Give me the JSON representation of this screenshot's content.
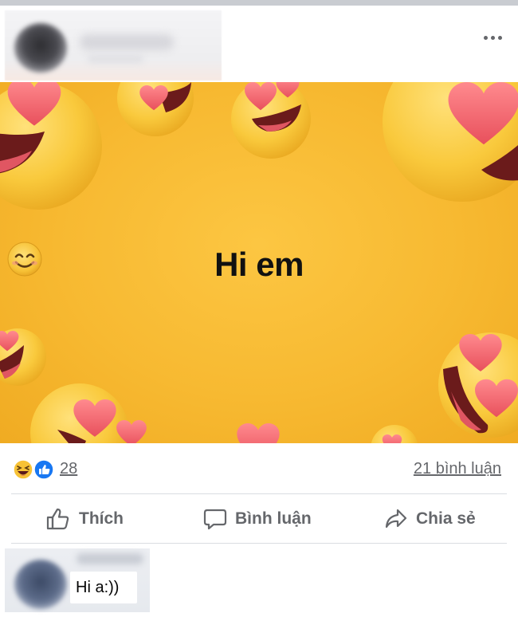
{
  "post": {
    "image_text": "Hi em",
    "image_text_emoji": "smiling-face-emoji"
  },
  "reactions": {
    "icons": [
      "haha-emoji-icon",
      "like-icon"
    ],
    "count": "28",
    "comments_label": "21 bình luận"
  },
  "actions": {
    "like_label": "Thích",
    "comment_label": "Bình luận",
    "share_label": "Chia sẻ"
  },
  "comment": {
    "text": "Hi a:))"
  },
  "colors": {
    "image_background": "#f7b931",
    "heart": "#f2606a",
    "emoji_face": "#f9c93c",
    "secondary_text": "#65676b",
    "like_blue": "#1877f2",
    "divider": "#dadde1"
  }
}
